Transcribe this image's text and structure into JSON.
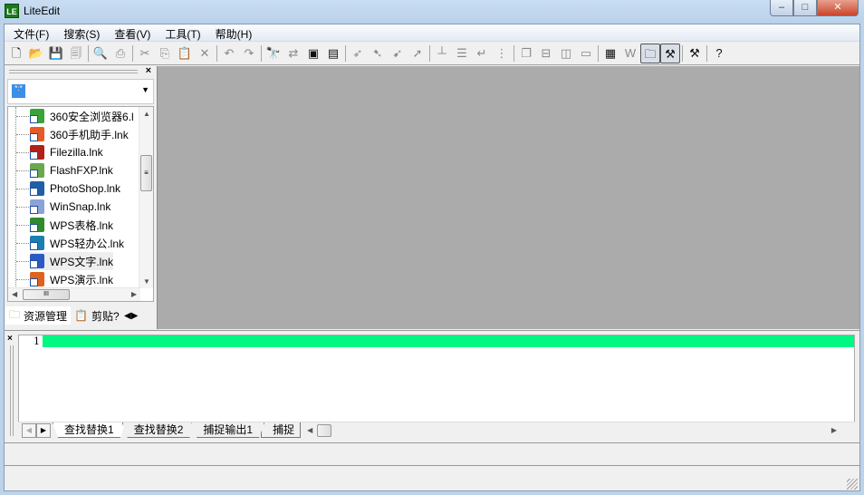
{
  "window": {
    "title": "LiteEdit",
    "icon_text": "LE",
    "min": "–",
    "max": "□",
    "close": "✕"
  },
  "menu": [
    "文件(F)",
    "搜索(S)",
    "查看(V)",
    "工具(T)",
    "帮助(H)"
  ],
  "toolbar": [
    {
      "name": "new-file",
      "g": "🗋",
      "on": true
    },
    {
      "name": "open-file",
      "g": "📂",
      "on": true
    },
    {
      "name": "save",
      "g": "💾"
    },
    {
      "name": "save-all",
      "g": "🗐"
    },
    "|",
    {
      "name": "print-preview",
      "g": "🔍"
    },
    {
      "name": "print",
      "g": "⎙"
    },
    "|",
    {
      "name": "cut",
      "g": "✂"
    },
    {
      "name": "copy",
      "g": "⎘"
    },
    {
      "name": "paste",
      "g": "📋"
    },
    {
      "name": "delete",
      "g": "✕"
    },
    "|",
    {
      "name": "undo",
      "g": "↶"
    },
    {
      "name": "redo",
      "g": "↷"
    },
    "|",
    {
      "name": "find",
      "g": "🔭",
      "on": true
    },
    {
      "name": "replace",
      "g": "⇄"
    },
    {
      "name": "find-in-files",
      "g": "▣",
      "on": true
    },
    {
      "name": "replace-in-files",
      "g": "▤",
      "on": true
    },
    "|",
    {
      "name": "bookmark",
      "g": "➶"
    },
    {
      "name": "prev-bookmark",
      "g": "➷"
    },
    {
      "name": "next-bookmark",
      "g": "➹"
    },
    {
      "name": "clear-bookmarks",
      "g": "➚"
    },
    "|",
    {
      "name": "ruler",
      "g": "┴"
    },
    {
      "name": "line-numbers",
      "g": "☰"
    },
    {
      "name": "word-wrap",
      "g": "↵"
    },
    {
      "name": "whitespace",
      "g": "⋮"
    },
    "|",
    {
      "name": "cascade",
      "g": "❐"
    },
    {
      "name": "tile-horizontal",
      "g": "⊟"
    },
    {
      "name": "tile-vertical",
      "g": "◫"
    },
    {
      "name": "window",
      "g": "▭"
    },
    "|",
    {
      "name": "output",
      "g": "▦",
      "on": true
    },
    {
      "name": "word",
      "g": "W"
    },
    {
      "name": "explorer-panel",
      "g": "🗀",
      "pressed": true
    },
    {
      "name": "output-panel",
      "g": "⚒",
      "pressed": true
    },
    "|",
    {
      "name": "tools",
      "g": "⚒",
      "on": true
    },
    "|",
    {
      "name": "help",
      "g": "?",
      "on": true
    }
  ],
  "explorer": {
    "close": "×",
    "drive": "*:*",
    "files": [
      {
        "name": "360安全浏览器6.l",
        "color": "#3aa33a"
      },
      {
        "name": "360手机助手.lnk",
        "color": "#e65a2a"
      },
      {
        "name": "Filezilla.lnk",
        "color": "#b3201a"
      },
      {
        "name": "FlashFXP.lnk",
        "color": "#6aa84f"
      },
      {
        "name": "PhotoShop.lnk",
        "color": "#1f5fa8"
      },
      {
        "name": "WinSnap.lnk",
        "color": "#8aa4d8"
      },
      {
        "name": "WPS表格.lnk",
        "color": "#2e8b2e"
      },
      {
        "name": "WPS轻办公.lnk",
        "color": "#1a7fb0"
      },
      {
        "name": "WPS文字.lnk",
        "color": "#2a5bc4"
      },
      {
        "name": "WPS演示.lnk",
        "color": "#e0621e"
      }
    ],
    "tabs": [
      "资源管理",
      "剪贴?"
    ],
    "scroll_thumb": "≡",
    "hscroll_thumb": "III"
  },
  "output": {
    "close": "×",
    "line_number": "1",
    "tabs": [
      "查找替换1",
      "查找替换2",
      "捕捉输出1",
      "捕捉"
    ]
  }
}
